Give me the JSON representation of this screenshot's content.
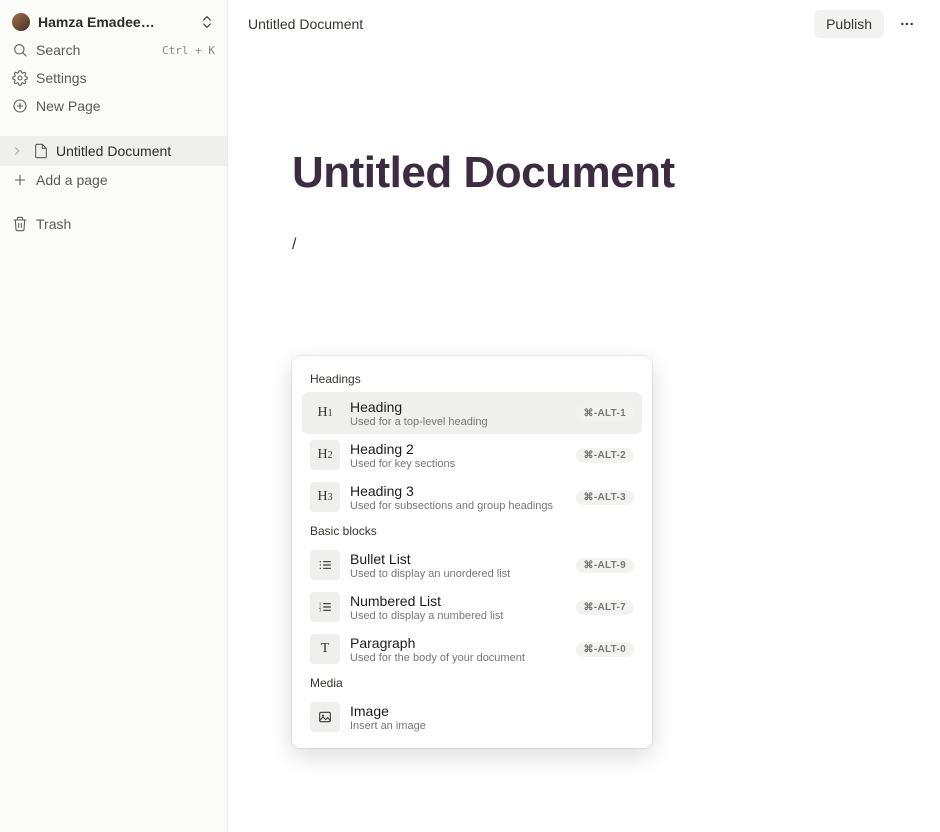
{
  "workspace": {
    "name": "Hamza Emadee…"
  },
  "sidebar": {
    "search_label": "Search",
    "search_shortcut": "Ctrl + K",
    "settings_label": "Settings",
    "new_page_label": "New Page",
    "add_page_label": "Add a page",
    "trash_label": "Trash",
    "pages": [
      {
        "title": "Untitled Document"
      }
    ]
  },
  "topbar": {
    "doc_title": "Untitled Document",
    "publish_label": "Publish"
  },
  "page": {
    "title": "Untitled Document",
    "slash_input": "/"
  },
  "command_menu": {
    "sections": [
      {
        "title": "Headings",
        "items": [
          {
            "icon": "H1",
            "label": "Heading",
            "desc": "Used for a top-level heading",
            "shortcut": "⌘-ALT-1"
          },
          {
            "icon": "H2",
            "label": "Heading 2",
            "desc": "Used for key sections",
            "shortcut": "⌘-ALT-2"
          },
          {
            "icon": "H3",
            "label": "Heading 3",
            "desc": "Used for subsections and group headings",
            "shortcut": "⌘-ALT-3"
          }
        ]
      },
      {
        "title": "Basic blocks",
        "items": [
          {
            "icon": "bullet",
            "label": "Bullet List",
            "desc": "Used to display an unordered list",
            "shortcut": "⌘-ALT-9"
          },
          {
            "icon": "numbered",
            "label": "Numbered List",
            "desc": "Used to display a numbered list",
            "shortcut": "⌘-ALT-7"
          },
          {
            "icon": "T",
            "label": "Paragraph",
            "desc": "Used for the body of your document",
            "shortcut": "⌘-ALT-0"
          }
        ]
      },
      {
        "title": "Media",
        "items": [
          {
            "icon": "image",
            "label": "Image",
            "desc": "Insert an image",
            "shortcut": ""
          }
        ]
      }
    ]
  }
}
